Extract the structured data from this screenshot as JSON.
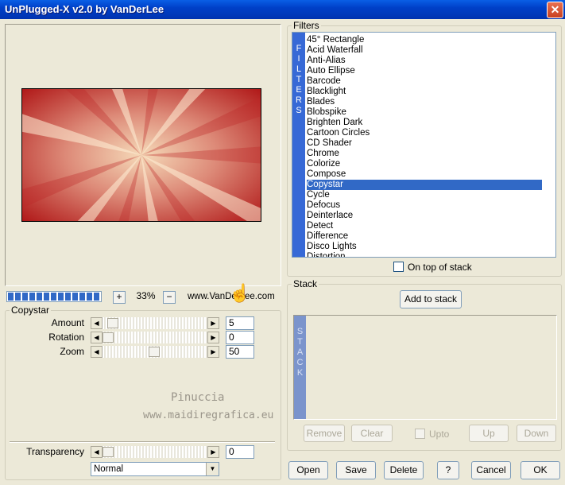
{
  "window": {
    "title": "UnPlugged-X v2.0 by VanDerLee",
    "close_icon": "close-icon"
  },
  "zoom": {
    "value": "33%",
    "plus": "+",
    "minus": "−"
  },
  "website": "www.VanDerLee.com",
  "filters": {
    "group_label": "Filters",
    "band_letters": [
      "F",
      "I",
      "L",
      "T",
      "E",
      "R",
      "S"
    ],
    "items": [
      "45° Rectangle",
      "Acid Waterfall",
      "Anti-Alias",
      "Auto Ellipse",
      "Barcode",
      "Blacklight",
      "Blades",
      "Blobspike",
      "Brighten Dark",
      "Cartoon Circles",
      "CD Shader",
      "Chrome",
      "Colorize",
      "Compose",
      "Copystar",
      "Cycle",
      "Defocus",
      "Deinterlace",
      "Detect",
      "Difference",
      "Disco Lights",
      "Distortion"
    ],
    "selected": "Copystar",
    "on_top_label": "On top of stack",
    "on_top_checked": false
  },
  "params": {
    "group_label": "Copystar",
    "sliders": [
      {
        "label": "Amount",
        "value": "5",
        "fraction": 0.05
      },
      {
        "label": "Rotation",
        "value": "0",
        "fraction": 0.0
      },
      {
        "label": "Zoom",
        "value": "50",
        "fraction": 0.5
      }
    ],
    "transparency": {
      "label": "Transparency",
      "value": "0",
      "fraction": 0.0
    },
    "blend_mode": "Normal"
  },
  "watermark": {
    "line1": "Pinuccia",
    "line2": "www.maidiregrafica.eu"
  },
  "stack": {
    "group_label": "Stack",
    "add_button": "Add to stack",
    "band_letters": [
      "S",
      "T",
      "A",
      "C",
      "K"
    ],
    "remove": "Remove",
    "clear": "Clear",
    "upto": "Upto",
    "up": "Up",
    "down": "Down"
  },
  "bottom_buttons": {
    "open": "Open",
    "save": "Save",
    "delete": "Delete",
    "help": "?",
    "cancel": "Cancel",
    "ok": "OK"
  },
  "progress_fraction": 1.0,
  "colors": {
    "accent": "#3169c6",
    "title_bar": "#0040c8"
  }
}
